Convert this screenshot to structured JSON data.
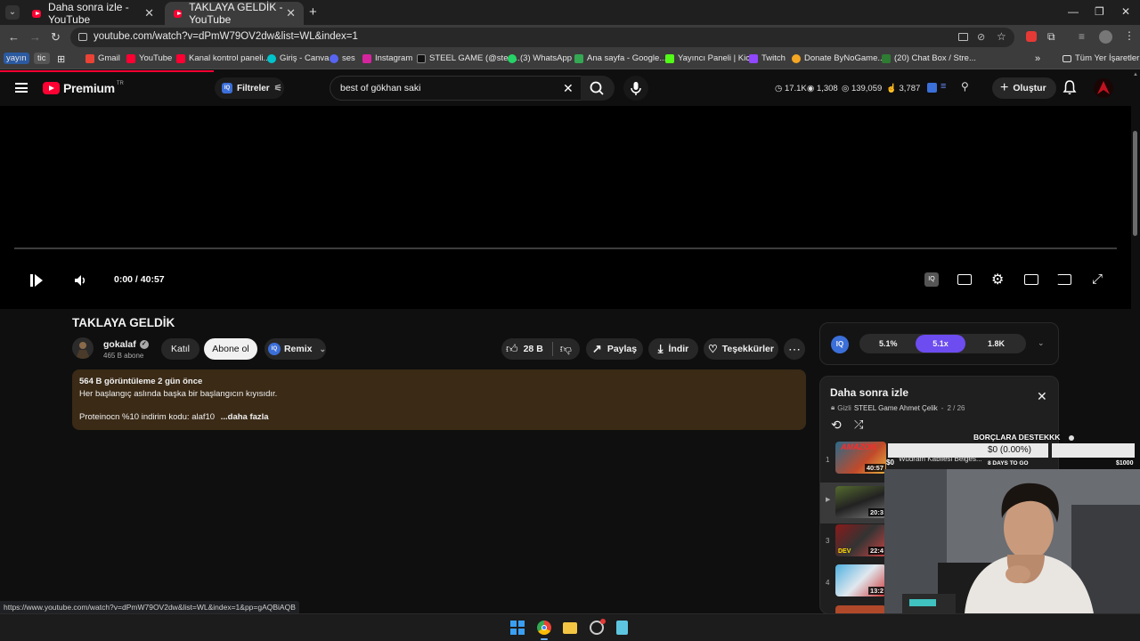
{
  "browser": {
    "tabs": [
      {
        "title": "Daha sonra izle - YouTube"
      },
      {
        "title": "TAKLAYA GELDİK - YouTube"
      }
    ],
    "url": "youtube.com/watch?v=dPmW79OV2dw&list=WL&index=1",
    "bookmarks": {
      "profile": "yayın",
      "tic": "tic",
      "items": [
        "Gmail",
        "YouTube",
        "Kanal kontrol paneli...",
        "Giriş - Canva",
        "ses",
        "Instagram",
        "STEEL GAME (@stee...",
        "(3) WhatsApp",
        "Ana sayfa - Google...",
        "Yayıncı Paneli | Kick",
        "Twitch",
        "Donate ByNoGame...",
        "(20) Chat Box / Stre..."
      ],
      "all_bookmarks": "Tüm Yer İşaretleri"
    }
  },
  "youtube": {
    "logo": "Premium",
    "region": "TR",
    "filters_label": "Filtreler",
    "search_value": "best of gökhan saki",
    "stats": [
      "17.1K",
      "1,308",
      "139,059",
      "3,787"
    ],
    "create_label": "Oluştur"
  },
  "player": {
    "time": "0:00 / 40:57",
    "progress": 0
  },
  "video": {
    "title": "TAKLAYA GELDİK",
    "channel": "gokalaf",
    "subscribers": "465 B abone",
    "join_label": "Katıl",
    "subscribe_label": "Abone ol",
    "remix_label": "Remix",
    "likes": "28 B",
    "share_label": "Paylaş",
    "download_label": "İndir",
    "thanks_label": "Teşekkürler",
    "meta": "564 B görüntüleme  2 gün önce",
    "desc_line1": "Her başlangıç aslında başka bir başlangıcın kıyısıdır.",
    "desc_line2": "Proteinocn %10 indirim kodu: alaf10",
    "more_label": "...daha fazla"
  },
  "ratings": {
    "iq": "IQ",
    "values": [
      "5.1%",
      "5.1x",
      "1.8K"
    ]
  },
  "playlist": {
    "title": "Daha sonra izle",
    "privacy": "Gizli",
    "owner": "STEEL Game Ahmet Çelik",
    "position": "2 / 26",
    "items": [
      {
        "num": "1",
        "duration": "40:57",
        "label": "AMAZON"
      },
      {
        "num": "",
        "duration": "20:3"
      },
      {
        "num": "3",
        "duration": "22:4",
        "label": "DEV"
      },
      {
        "num": "4",
        "duration": "13:2"
      }
    ]
  },
  "donation": {
    "title": "BORÇLARA DESTEKKK",
    "amount": "$0 (0.00%)",
    "min": "$0",
    "max": "$1000",
    "days": "8 DAYS TO GO",
    "behind_text": "Wudram Kabilesi Belges..."
  },
  "status_url": "https://www.youtube.com/watch?v=dPmW79OV2dw&list=WL&index=1&pp=gAQBiAQB"
}
